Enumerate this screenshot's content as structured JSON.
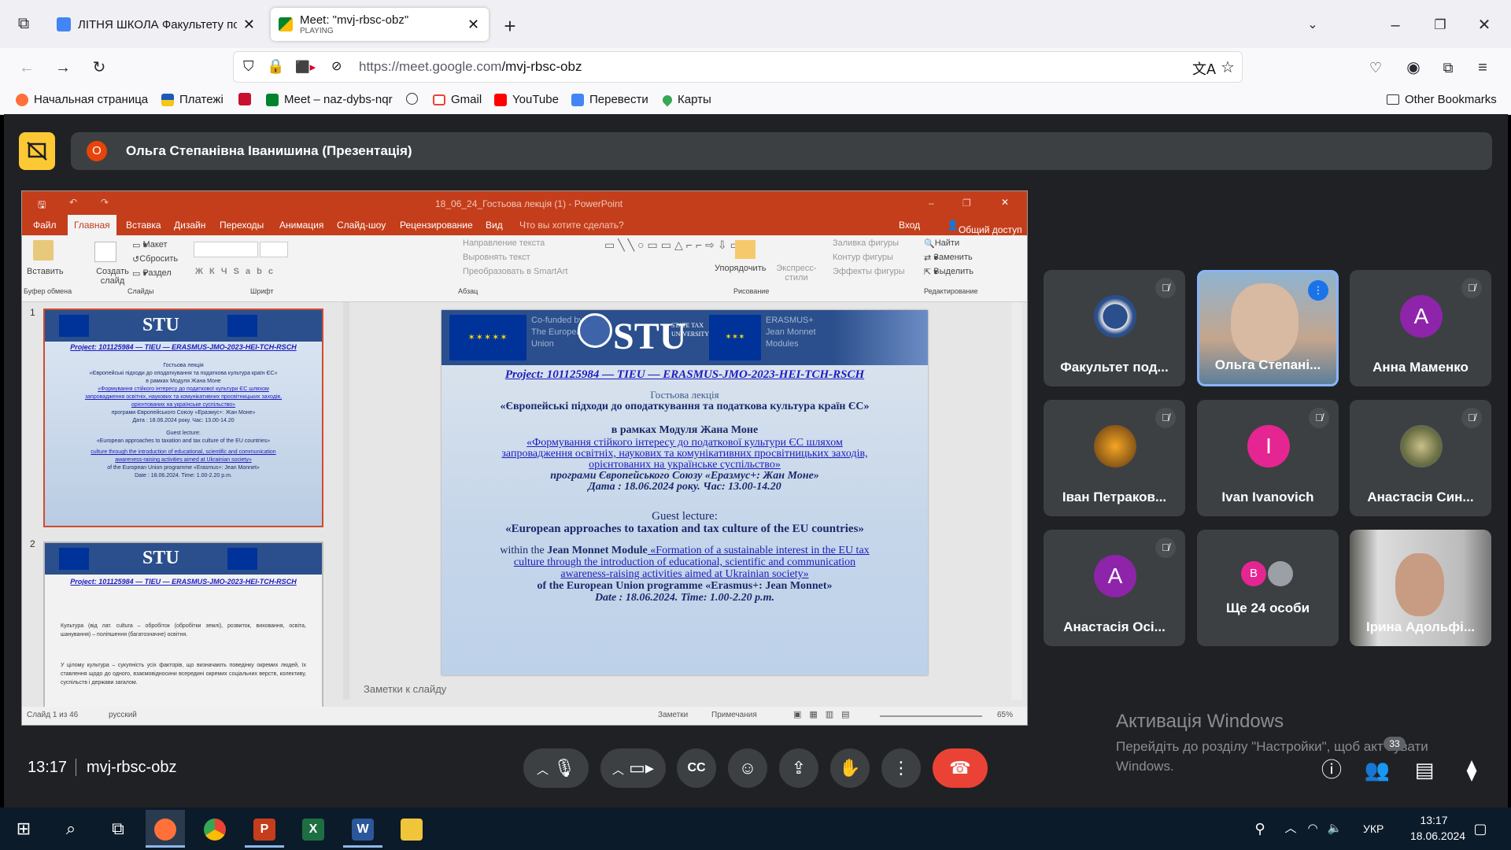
{
  "browser": {
    "tabs": [
      {
        "label": "ЛІТНЯ ШКОЛА Факультету под",
        "sublabel": ""
      },
      {
        "label": "Meet: \"mvj-rbsc-obz\"",
        "sublabel": "PLAYING"
      }
    ],
    "new_tab": "+",
    "url_host": "https://meet.google.com",
    "url_path": "/mvj-rbsc-obz",
    "bookmarks": [
      "Начальная страница",
      "Платежі",
      "Meet – naz-dybs-nqr",
      "Gmail",
      "YouTube",
      "Перевести",
      "Карты"
    ],
    "other_bookmarks": "Other Bookmarks"
  },
  "meet": {
    "presenter_badge": "О",
    "presenter_title": "Ольга Степанівна Іванишина (Презентація)",
    "time": "13:17",
    "meeting_code": "mvj-rbsc-obz",
    "participants_count": "33",
    "tiles": [
      {
        "name": "Факультет под...",
        "muted": true,
        "avatar": "logo"
      },
      {
        "name": "Ольга Степані...",
        "muted": false,
        "avatar": "video",
        "speaking": true
      },
      {
        "name": "Анна Маменко",
        "muted": true,
        "avatar": "А",
        "color": "#8e24aa"
      },
      {
        "name": "Іван Петраков...",
        "muted": true,
        "avatar": "photo"
      },
      {
        "name": "Ivan Ivanovich",
        "muted": true,
        "avatar": "I",
        "color": "#e52592"
      },
      {
        "name": "Анастасія Син...",
        "muted": true,
        "avatar": "photo"
      },
      {
        "name": "Анастасія Осі...",
        "muted": true,
        "avatar": "А",
        "color": "#8e24aa"
      },
      {
        "name": "Ще 24 особи",
        "muted": false,
        "avatar": "В",
        "color": "#e52592"
      },
      {
        "name": "Ірина Адольфі...",
        "muted": false,
        "avatar": "video"
      }
    ],
    "watermark_title": "Активація Windows",
    "watermark_line1": "Перейдіть до розділу \"Настройки\", щоб акт вувати",
    "watermark_line2": "Windows."
  },
  "ppt": {
    "title": "18_06_24_Гостьова лекція (1) - PowerPoint",
    "sign_in": "Вход",
    "share": "Общий доступ",
    "menu": [
      "Файл",
      "Главная",
      "Вставка",
      "Дизайн",
      "Переходы",
      "Анимация",
      "Слайд-шоу",
      "Рецензирование",
      "Вид",
      "Что вы хотите сделать?"
    ],
    "ribbon": {
      "paste": "Вставить",
      "create_slide": "Создать слайд",
      "layout": "Макет",
      "reset": "Сбросить",
      "section": "Раздел",
      "groups": [
        "Буфер обмена",
        "Слайды",
        "Шрифт",
        "Абзац",
        "Рисование",
        "Редактирование"
      ],
      "text_dir": "Направление текста",
      "align_text": "Выровнять текст",
      "smartart": "Преобразовать в SmartArt",
      "arrange": "Упорядочить",
      "quick_styles": "Экспресс-стили",
      "fill": "Заливка фигуры",
      "outline": "Контур фигуры",
      "effects": "Эффекты фигуры",
      "find": "Найти",
      "replace": "Заменить",
      "select": "Выделить"
    },
    "notes_placeholder": "Заметки к слайду",
    "status_slide": "Слайд 1 из 46",
    "status_lang": "русский",
    "status_notes": "Заметки",
    "status_comments": "Примечания",
    "zoom": "65%",
    "thumb_numbers": [
      "1",
      "2"
    ],
    "thumb2_text1": "Культура (від лат. cultura – обробіток (обробітки землі), розвиток, виховання, освіта, шанування) – поліпшення (багатозначне) освітня.",
    "thumb2_text2": "У цілому культура – сукупність усіх факторів, що визначають поведінку окремих людей, їх ставлення щодо до одного, взаємовідносини всередині окремих соціальних верств, колективу, суспільств і держави загалом.",
    "slide": {
      "cofunded": "Co-funded by The European Union",
      "stu": "STU",
      "stu_sub": "STATE TAX UNIVERSITY",
      "erasmus": "ERASMUS+ Jean Monnet Modules",
      "project": "Project: 101125984 — TIEU — ERASMUS-JMO-2023-HEI-TCH-RSCH",
      "lecture_label": "Гостьова лекція",
      "lecture_title": "«Європейські підходи до оподаткування та податкова культура країн ЄС»",
      "within_ua": "в рамках Модуля Жана Моне",
      "module_ua_1": "«Формування стійкого інтересу до податкової культури ЄС шляхом",
      "module_ua_2": "запровадження освітніх, наукових та комунікативних просвітницьких заходів,",
      "module_ua_3": "орієнтованих на українське суспільство»",
      "programme_ua": "програми Європейського Союзу «Еразмус+: Жан Моне»",
      "date_ua": "Дата : 18.06.2024 року. Час: 13.00-14.20",
      "guest": "Guest lecture:",
      "title_en": "«European approaches to taxation and tax culture of the EU countries»",
      "within_en_a": "within the ",
      "within_en_b": "Jean Monnet Module",
      "module_en_1": " «Formation of a sustainable interest in the EU tax",
      "module_en_2": "culture through the introduction of educational, scientific and communication",
      "module_en_3": "awareness-raising activities aimed at Ukrainian society»",
      "programme_en": "of the European Union programme «Erasmus+: Jean Monnet»",
      "date_en": "Date : 18.06.2024. Time: 1.00-2.20 p.m."
    }
  },
  "taskbar": {
    "lang": "УКР",
    "time": "13:17",
    "date": "18.06.2024"
  },
  "colors": {
    "meet_bg": "#202124",
    "tile_bg": "#3c4043",
    "end_call": "#ea4335",
    "ppt_accent": "#c43e1c",
    "present_badge": "#fcc934"
  }
}
